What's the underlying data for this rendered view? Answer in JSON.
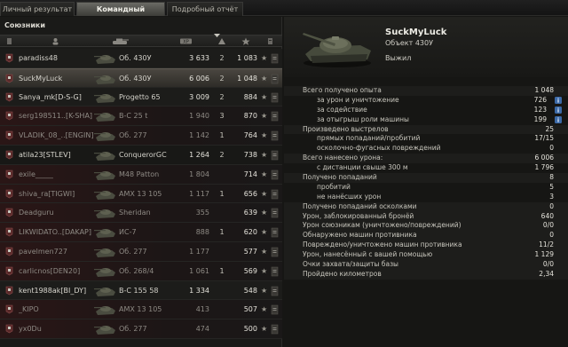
{
  "tabs": [
    {
      "label": "Личный результат",
      "active": false
    },
    {
      "label": "Командный результат",
      "active": true
    },
    {
      "label": "Подробный отчёт",
      "active": false
    }
  ],
  "team": {
    "title": "Союзники",
    "players": [
      {
        "player": "paradiss48",
        "vehicle": "Об. 430У",
        "xp": "3 633",
        "kills": "2",
        "score": "1 083",
        "state": "alive"
      },
      {
        "player": "SuckMyLuck",
        "vehicle": "Об. 430У",
        "xp": "6 006",
        "kills": "2",
        "score": "1 048",
        "state": "selected"
      },
      {
        "player": "Sanya_mk[D-S-G]",
        "vehicle": "Progetto 65",
        "xp": "3 009",
        "kills": "2",
        "score": "884",
        "state": "alive"
      },
      {
        "player": "serg198511..[K-SHA]",
        "vehicle": "B-C 25 t",
        "xp": "1 940",
        "kills": "3",
        "score": "870",
        "state": "dead"
      },
      {
        "player": "VLADIK_08_..[ENGIN]",
        "vehicle": "Об. 277",
        "xp": "1 142",
        "kills": "1",
        "score": "764",
        "state": "dead"
      },
      {
        "player": "atila23[STLEV]",
        "vehicle": "ConquerorGC",
        "xp": "1 264",
        "kills": "2",
        "score": "738",
        "state": "alive"
      },
      {
        "player": "exile_____",
        "vehicle": "M48 Patton",
        "xp": "1 804",
        "kills": "",
        "score": "714",
        "state": "dead"
      },
      {
        "player": "shiva_ra[TIGWI]",
        "vehicle": "AMX 13 105",
        "xp": "1 117",
        "kills": "1",
        "score": "656",
        "state": "dead"
      },
      {
        "player": "Deadguru",
        "vehicle": "Sheridan",
        "xp": "355",
        "kills": "",
        "score": "639",
        "state": "dead"
      },
      {
        "player": "LIKWIDATO..[DAKAP]",
        "vehicle": "ИС-7",
        "xp": "888",
        "kills": "1",
        "score": "620",
        "state": "dead"
      },
      {
        "player": "pavelmen727",
        "vehicle": "Об. 277",
        "xp": "1 177",
        "kills": "",
        "score": "577",
        "state": "dead"
      },
      {
        "player": "carlicnos[DEN20]",
        "vehicle": "Об. 268/4",
        "xp": "1 061",
        "kills": "1",
        "score": "569",
        "state": "dead"
      },
      {
        "player": "kent1988ak[BI_DY]",
        "vehicle": "B-C 155 58",
        "xp": "1 334",
        "kills": "",
        "score": "548",
        "state": "alive"
      },
      {
        "player": "_KIPO",
        "vehicle": "AMX 13 105",
        "xp": "413",
        "kills": "",
        "score": "507",
        "state": "dead"
      },
      {
        "player": "yx0Du",
        "vehicle": "Об. 277",
        "xp": "474",
        "kills": "",
        "score": "500",
        "state": "dead"
      }
    ]
  },
  "details": {
    "player_name": "SuckMyLuck",
    "tank_name": "Объект 430У",
    "status": "Выжил",
    "stats": [
      {
        "label": "Всего получено опыта",
        "value": "1 048",
        "level": 0,
        "info": false
      },
      {
        "label": "за урон и уничтожение",
        "value": "726",
        "level": 1,
        "info": true
      },
      {
        "label": "за содействие",
        "value": "123",
        "level": 1,
        "info": true
      },
      {
        "label": "за отыгрыш роли машины",
        "value": "199",
        "level": 1,
        "info": true
      },
      {
        "label": "Произведено выстрелов",
        "value": "25",
        "level": 0,
        "info": false
      },
      {
        "label": "прямых попаданий/пробитий",
        "value": "17/15",
        "level": 1,
        "info": false
      },
      {
        "label": "осколочно-фугасных повреждений",
        "value": "0",
        "level": 1,
        "info": false
      },
      {
        "label": "Всего нанесено урона:",
        "value": "6 006",
        "level": 0,
        "info": false
      },
      {
        "label": "с дистанции свыше 300 м",
        "value": "1 796",
        "level": 1,
        "info": false
      },
      {
        "label": "Получено попаданий",
        "value": "8",
        "level": 0,
        "info": false
      },
      {
        "label": "пробитий",
        "value": "5",
        "level": 1,
        "info": false
      },
      {
        "label": "не нанёсших урон",
        "value": "3",
        "level": 1,
        "info": false
      },
      {
        "label": "Получено попаданий осколками",
        "value": "0",
        "level": 0,
        "info": false
      },
      {
        "label": "Урон, заблокированный бронёй",
        "value": "640",
        "level": 0,
        "info": false
      },
      {
        "label": "Урон союзникам (уничтожено/повреждений)",
        "value": "0/0",
        "level": 0,
        "info": false
      },
      {
        "label": "Обнаружено машин противника",
        "value": "0",
        "level": 0,
        "info": false
      },
      {
        "label": "Повреждено/уничтожено машин противника",
        "value": "11/2",
        "level": 0,
        "info": false
      },
      {
        "label": "Урон, нанесённый с вашей помощью",
        "value": "1 129",
        "level": 0,
        "info": false
      },
      {
        "label": "Очки захвата/защиты базы",
        "value": "0/0",
        "level": 0,
        "info": false
      },
      {
        "label": "Пройдено километров",
        "value": "2,34",
        "level": 0,
        "info": false
      }
    ]
  },
  "colors": {
    "dead_row": "#2a1616",
    "selected_row": "#4a4640",
    "active_tab": "#5a5a54",
    "info_icon": "#3c6aa8"
  }
}
